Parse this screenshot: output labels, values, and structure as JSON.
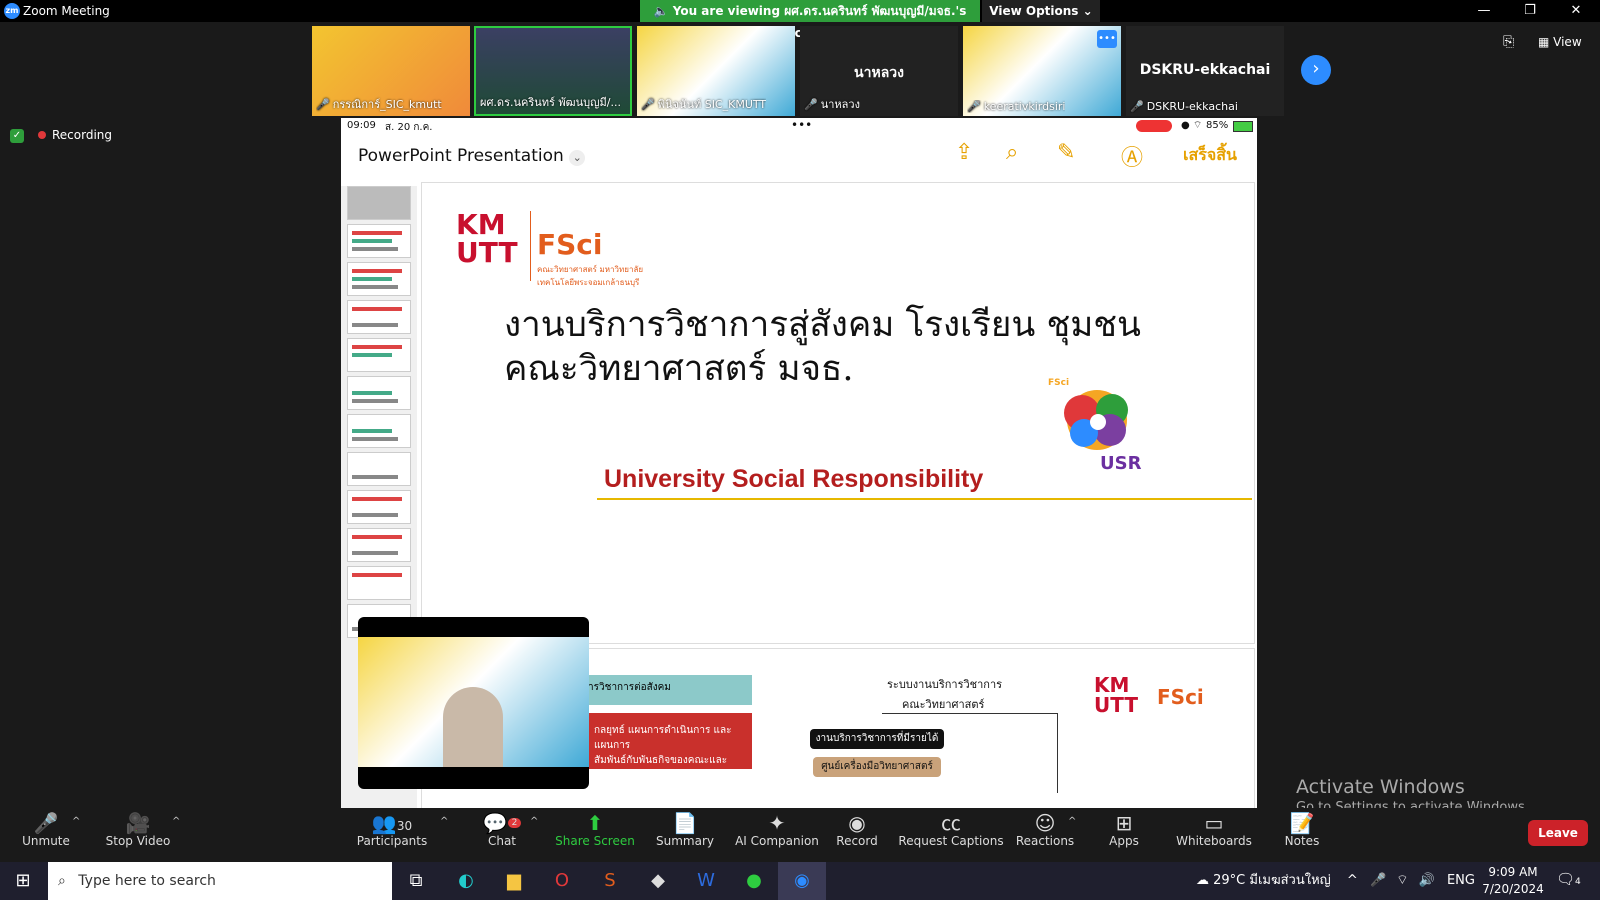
{
  "window": {
    "title": "Zoom Meeting",
    "logo": "zm"
  },
  "banner": {
    "viewing": "You are viewing ผศ.ดร.นครินทร์ พัฒนบุญมี/มจธ.'s screen",
    "view_options": "View Options"
  },
  "participants_strip": [
    {
      "name": "กรรณิการ์_SIC_kmutt",
      "muted": true
    },
    {
      "name": "ผศ.ดร.นครินทร์ พัฒนบุญมี/...",
      "muted": false
    },
    {
      "name": "พินิจนันท์ SIC_KMUTT",
      "muted": true
    },
    {
      "name": "นาหลวง",
      "big_label": "นาหลวง",
      "muted": true
    },
    {
      "name": "keerativkirdsiri",
      "muted": true
    },
    {
      "name": "DSKRU-ekkachai",
      "big_label": "DSKRU-ekkachai",
      "muted": true
    }
  ],
  "recording": {
    "label": "Recording"
  },
  "view_button": "View",
  "ipad": {
    "time": "09:09",
    "date": "ส. 20 ก.ค.",
    "battery": "85%",
    "dots": "•••"
  },
  "ppt": {
    "title": "PowerPoint Presentation",
    "done": "เสร็จสิ้น",
    "slide1": {
      "kmutt": "KM\nUTT",
      "fsci": "FSci",
      "fsci_sub": "คณะวิทยาศาสตร์ มหาวิทยาลัยเทคโนโลยีพระจอมเกล้าธนบุรี",
      "title_line1": "งานบริการวิชาการสู่สังคม โรงเรียน ชุมชน",
      "title_line2": "คณะวิทยาศาสตร์ มจธ.",
      "usr_heading": "University Social Responsibility",
      "usr_logo": "USR",
      "usr_fsci": "FSci"
    },
    "slide2": {
      "box1": "การวิชาการต่อสังคม",
      "heading": "ระบบงานบริการวิชาการ",
      "subheading": "คณะวิทยาศาสตร์",
      "node1": "งานบริการวิชาการที่มีรายได้",
      "node2": "ศูนย์เครื่องมือวิทยาศาสตร์",
      "box2_line1": "กลยุทธ์ แผนการดำเนินการ และแผนการ",
      "box2_line2": "สัมพันธ์กับพันธกิจของคณะและมหาวิทยาลัย"
    }
  },
  "activate": {
    "line1": "Activate Windows",
    "line2": "Go to Settings to activate Windows."
  },
  "toolbar": {
    "unmute": "Unmute",
    "stop_video": "Stop Video",
    "participants": "Participants",
    "participants_count": "30",
    "chat": "Chat",
    "chat_badge": "2",
    "share_screen": "Share Screen",
    "summary": "Summary",
    "ai_companion": "AI Companion",
    "record": "Record",
    "captions": "Request Captions",
    "reactions": "Reactions",
    "apps": "Apps",
    "whiteboards": "Whiteboards",
    "notes": "Notes",
    "leave": "Leave"
  },
  "taskbar": {
    "search_placeholder": "Type here to search",
    "weather": "29°C  มีเมฆส่วนใหญ่",
    "lang": "ENG",
    "time": "9:09 AM",
    "date": "7/20/2024",
    "notif_count": "4"
  }
}
